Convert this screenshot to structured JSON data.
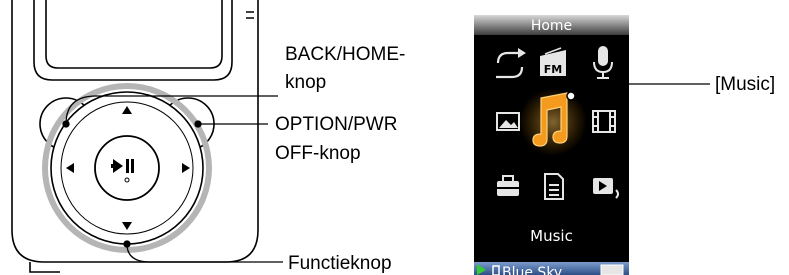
{
  "left_callouts": {
    "back_home": [
      "BACK/HOME-",
      "knop"
    ],
    "option_pwr": [
      "OPTION/PWR",
      "OFF-knop"
    ],
    "function_button": "Functieknop"
  },
  "right_callouts": {
    "music": "[Music]"
  },
  "device_screen": {
    "header": "Home",
    "selected_label": "Music",
    "status_bar_track": "Blue Sky",
    "icons": [
      [
        "repeat-icon",
        "fm-radio-icon",
        "microphone-icon"
      ],
      [
        "photo-icon",
        "music-note-icon",
        "video-icon"
      ],
      [
        "settings-toolbox-icon",
        "podcast-document-icon",
        "now-playing-icon"
      ]
    ],
    "fm_label": "FM"
  },
  "colors": {
    "device_outline": "#000000",
    "screen_background": "#000000",
    "header_gradient_top": "#c8c8c8",
    "header_gradient_bottom": "#555555",
    "icon_white": "#e6e6e6",
    "music_highlight": "#f39a1f",
    "status_bar": "#4a6fa8",
    "play_green": "#33cc33"
  }
}
